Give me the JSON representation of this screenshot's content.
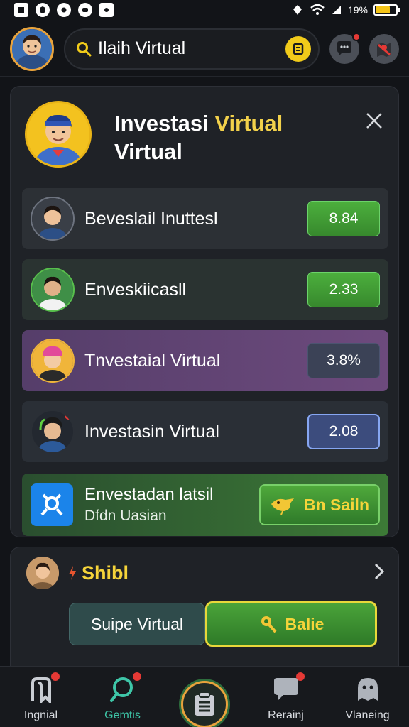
{
  "status": {
    "battery_text": "19%"
  },
  "header": {
    "search_text": "Ilaih Virtual",
    "search_badge": "Ꞁ"
  },
  "panel": {
    "title_line1_plain": "Investasi",
    "title_line1_highlight": "Virtual",
    "title_line2": "Virtual",
    "items": [
      {
        "label": "Beveslail Inuttesl",
        "value": "8.84"
      },
      {
        "label": "Enveskiicasll",
        "value": "2.33"
      },
      {
        "label": "Tnvestaial Virtual",
        "value": "3.8%"
      },
      {
        "label": "Investasin Virtual",
        "value": "2.08"
      }
    ],
    "promo": {
      "title": "Envestadan latsil",
      "subtitle": "Dfdn Uasian",
      "button": "Bn Sailn"
    }
  },
  "card2": {
    "title": "Shibl",
    "button1": "Suipe Virtual",
    "button2": "Balie"
  },
  "nav": {
    "items": [
      {
        "label": "Ingnial"
      },
      {
        "label": "Gemtis"
      },
      {
        "label": "Rerainj"
      },
      {
        "label": "Vlaneing"
      }
    ]
  },
  "colors": {
    "accent_yellow": "#f2d14b",
    "green": "#3f9a34",
    "teal_active": "#3ec6a8"
  }
}
